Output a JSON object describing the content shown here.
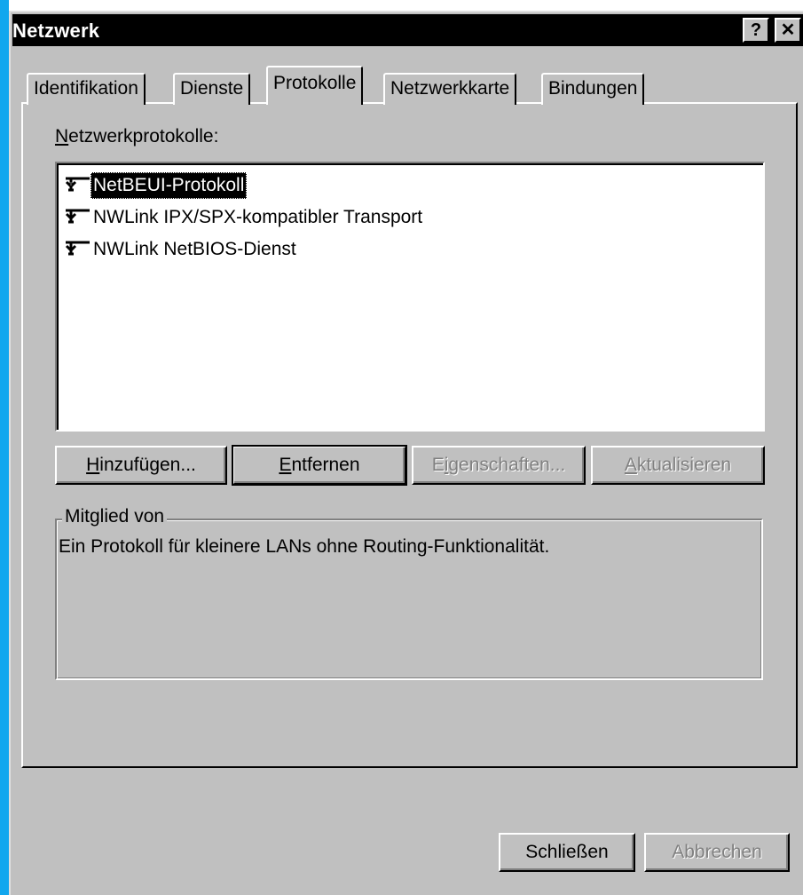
{
  "window": {
    "title": "Netzwerk",
    "help_button": "?",
    "close_button": "✕"
  },
  "tabs": [
    {
      "label": "Identifikation"
    },
    {
      "label": "Dienste"
    },
    {
      "label": "Protokolle",
      "active": true
    },
    {
      "label": "Netzwerkkarte"
    },
    {
      "label": "Bindungen"
    }
  ],
  "protocols_section": {
    "label_accel": "N",
    "label_rest": "etzwerkprotokolle:",
    "items": [
      {
        "label": "NetBEUI-Protokoll",
        "icon": "network-protocol-icon",
        "selected": true
      },
      {
        "label": "NWLink IPX/SPX-kompatibler Transport",
        "icon": "network-protocol-icon",
        "selected": false
      },
      {
        "label": "NWLink NetBIOS-Dienst",
        "icon": "network-protocol-icon",
        "selected": false
      }
    ]
  },
  "buttons": {
    "add": {
      "accel": "H",
      "rest": "inzufügen..."
    },
    "remove": {
      "accel": "E",
      "rest": "ntfernen"
    },
    "properties": {
      "pre": "E",
      "accel": "i",
      "rest": "genschaften..."
    },
    "update": {
      "accel": "A",
      "rest": "ktualisieren"
    }
  },
  "group": {
    "legend": "Mitglied von",
    "description": "Ein Protokoll für kleinere LANs ohne Routing-Funktionalität."
  },
  "footer": {
    "close": "Schließen",
    "cancel": "Abbrechen"
  },
  "colors": {
    "face": "#c0c0c0",
    "titlebar": "#000000",
    "desktop_stripe": "#11a7ee",
    "disabled_text": "#808080"
  }
}
